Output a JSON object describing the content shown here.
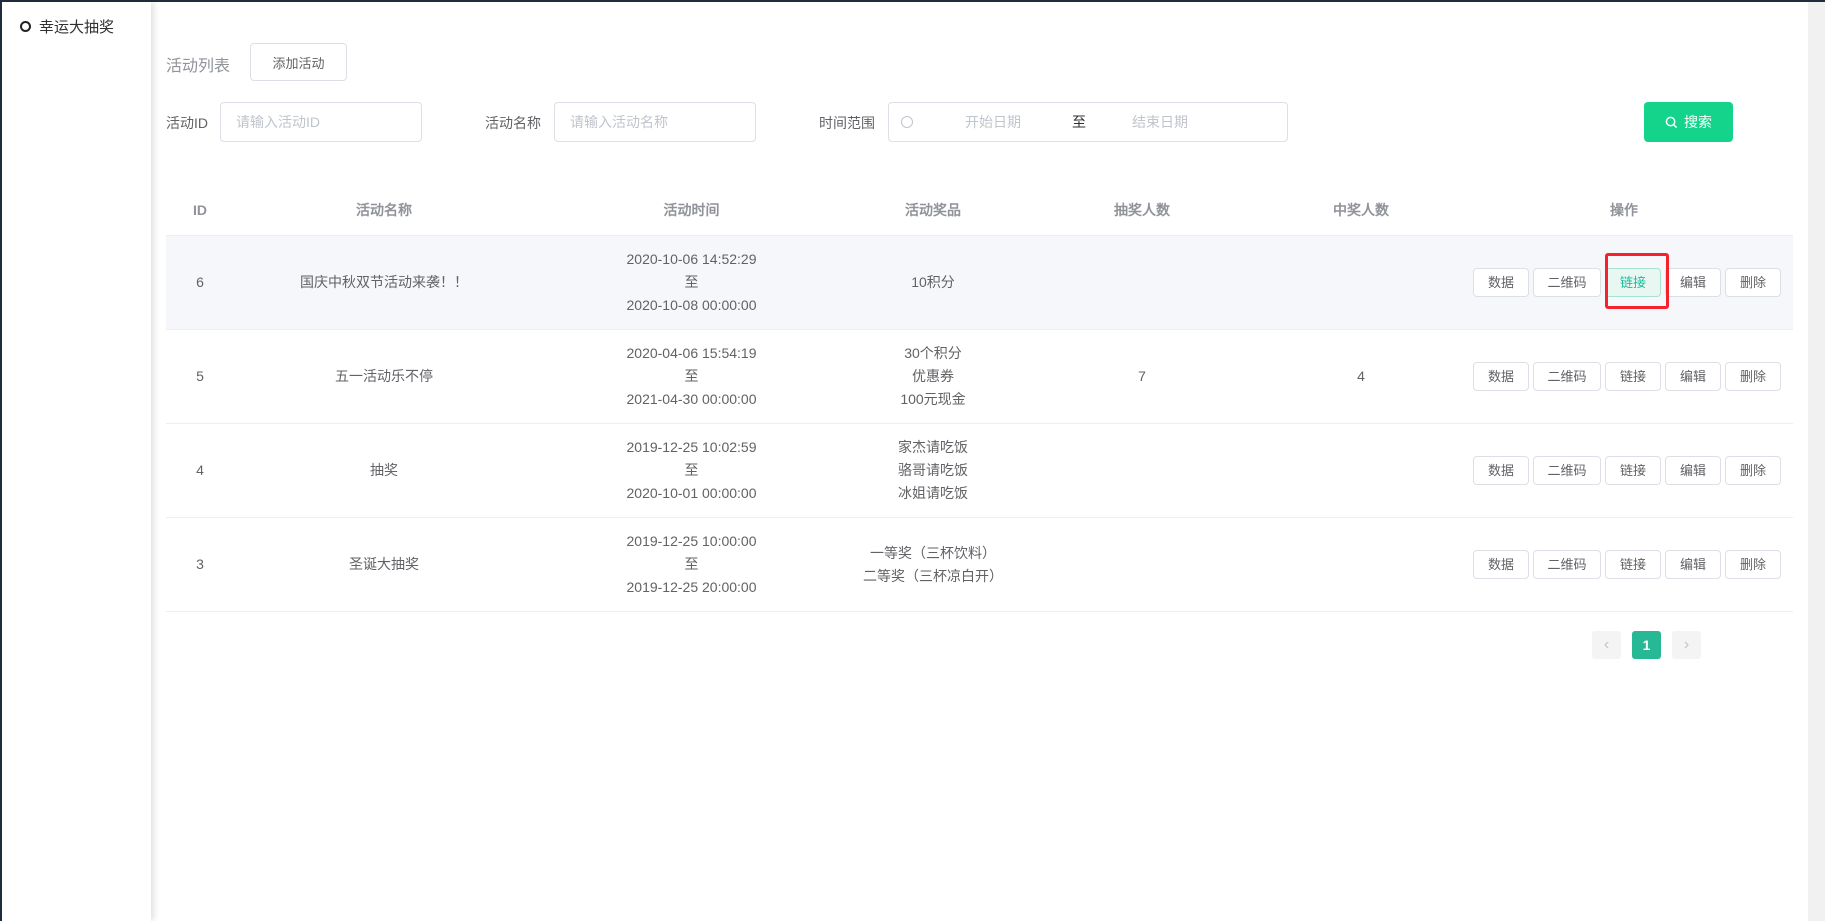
{
  "sidebar": {
    "items": [
      {
        "label": "幸运大抽奖"
      }
    ]
  },
  "header": {
    "title": "活动列表",
    "add_button": "添加活动"
  },
  "filters": {
    "id_label": "活动ID",
    "id_placeholder": "请输入活动ID",
    "name_label": "活动名称",
    "name_placeholder": "请输入活动名称",
    "range_label": "时间范围",
    "start_placeholder": "开始日期",
    "separator": "至",
    "end_placeholder": "结束日期",
    "search_button": "搜索"
  },
  "table": {
    "columns": [
      "ID",
      "活动名称",
      "活动时间",
      "活动奖品",
      "抽奖人数",
      "中奖人数",
      "操作"
    ],
    "actions": [
      "数据",
      "二维码",
      "链接",
      "编辑",
      "删除"
    ],
    "rows": [
      {
        "id": "6",
        "name": "国庆中秋双节活动来袭！！",
        "start": "2020-10-06 14:52:29",
        "to": "至",
        "end": "2020-10-08 00:00:00",
        "prizes": [
          "10积分"
        ],
        "participants": "",
        "winners": ""
      },
      {
        "id": "5",
        "name": "五一活动乐不停",
        "start": "2020-04-06 15:54:19",
        "to": "至",
        "end": "2021-04-30 00:00:00",
        "prizes": [
          "30个积分",
          "优惠券",
          "100元现金"
        ],
        "participants": "7",
        "winners": "4"
      },
      {
        "id": "4",
        "name": "抽奖",
        "start": "2019-12-25 10:02:59",
        "to": "至",
        "end": "2020-10-01 00:00:00",
        "prizes": [
          "家杰请吃饭",
          "骆哥请吃饭",
          "冰姐请吃饭"
        ],
        "participants": "",
        "winners": ""
      },
      {
        "id": "3",
        "name": "圣诞大抽奖",
        "start": "2019-12-25 10:00:00",
        "to": "至",
        "end": "2019-12-25 20:00:00",
        "prizes": [
          "一等奖（三杯饮料）",
          "二等奖（三杯凉白开）"
        ],
        "participants": "",
        "winners": ""
      }
    ]
  },
  "pagination": {
    "prev": "‹",
    "current": "1",
    "next": "›"
  },
  "colors": {
    "primary": "#13d48a",
    "page_active": "#27b996",
    "highlight": "#f5222d"
  }
}
